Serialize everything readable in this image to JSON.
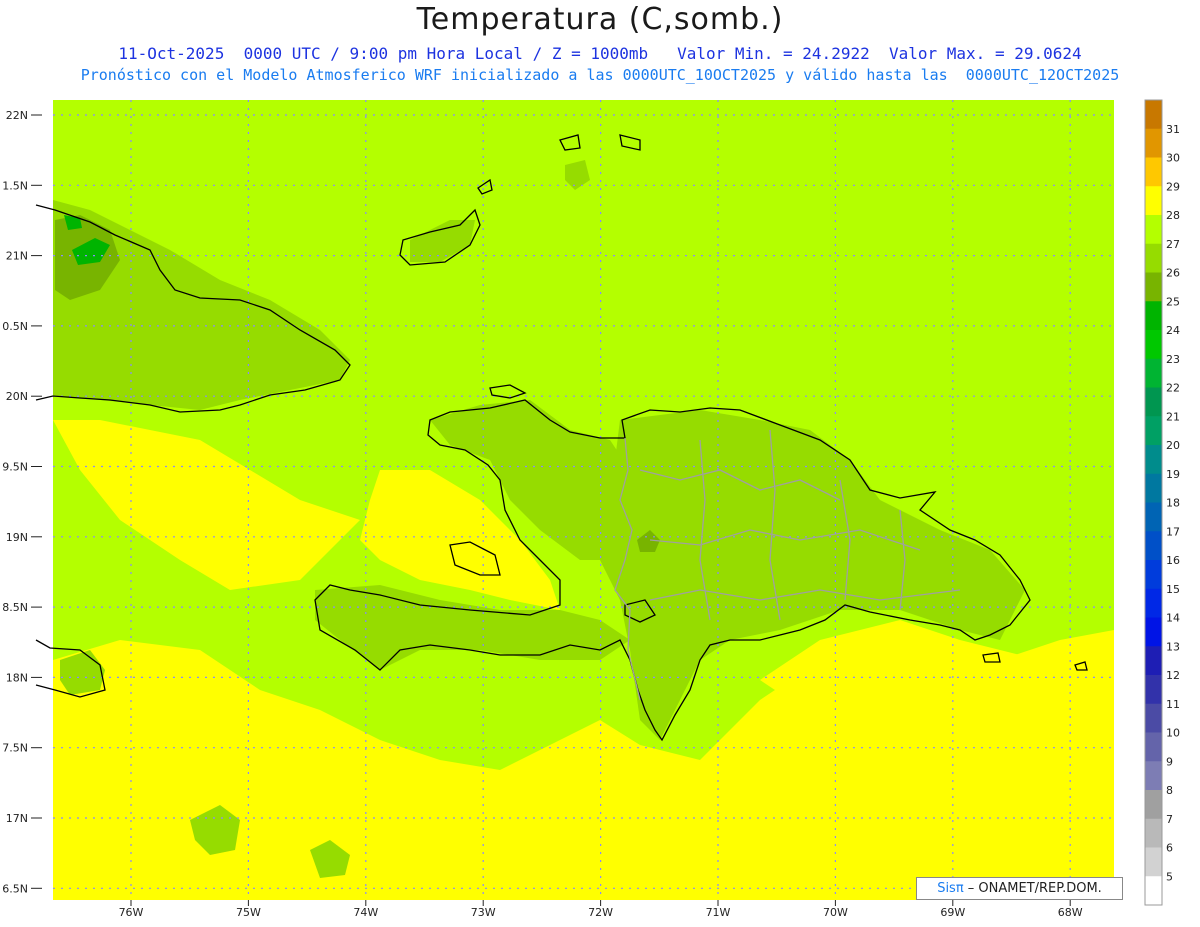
{
  "title": "Temperatura (C,somb.)",
  "subtitle_line1": "11-Oct-2025  0000 UTC / 9:00 pm Hora Local / Z = 1000mb   Valor Min. = 24.2922  Valor Max. = 29.0624",
  "subtitle_line2": "Pronóstico con el Modelo Atmosferico WRF inicializado a las 0000UTC_10OCT2025 y válido hasta las  0000UTC_12OCT2025",
  "credit": {
    "brand": "Sisπ",
    "org": " – ONAMET/REP.DOM."
  },
  "lat_labels": [
    "22N",
    "1.5N",
    "21N",
    "0.5N",
    "20N",
    "9.5N",
    "19N",
    "8.5N",
    "18N",
    "7.5N",
    "17N",
    "6.5N"
  ],
  "lon_labels": [
    "76W",
    "75W",
    "74W",
    "73W",
    "72W",
    "71W",
    "70W",
    "69W",
    "68W"
  ],
  "colorbar": {
    "labels": [
      "31",
      "30",
      "29",
      "28",
      "27",
      "26",
      "25",
      "24",
      "23",
      "22",
      "21",
      "20",
      "19",
      "18",
      "17",
      "16",
      "15",
      "14",
      "13",
      "12",
      "11",
      "10",
      "9",
      "8",
      "7",
      "6",
      "5"
    ],
    "colors": [
      "#c87800",
      "#e19600",
      "#ffc800",
      "#ffff00",
      "#b4ff00",
      "#96dc00",
      "#78b400",
      "#00b400",
      "#00c800",
      "#00b432",
      "#009650",
      "#00a064",
      "#008c8c",
      "#0078a0",
      "#0064b4",
      "#0050c8",
      "#003cdc",
      "#0028e6",
      "#0014e6",
      "#1e1eb4",
      "#3232aa",
      "#4b4ba5",
      "#6464aa",
      "#7d7db4",
      "#a0a0a0",
      "#b9b9b9",
      "#d2d2d2",
      "#ffffff"
    ]
  },
  "field_colors": {
    "t26": "#96dc00",
    "t27": "#b4ff00",
    "t28": "#ffff00",
    "t25": "#78b400",
    "t24": "#00b400",
    "coast": "#000000",
    "border": "#a0a0a0",
    "grid": "#8888ff"
  }
}
